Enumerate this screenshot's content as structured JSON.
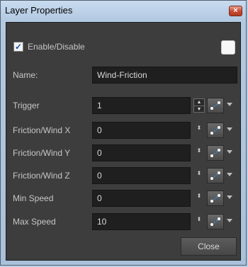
{
  "window": {
    "title": "Layer Properties",
    "close_glyph": "×"
  },
  "enable": {
    "label": "Enable/Disable",
    "checked": true,
    "check_glyph": "✓"
  },
  "color_swatch": {
    "color": "#f7f7f7"
  },
  "name_field": {
    "label": "Name:",
    "value": "Wind-Friction"
  },
  "params": [
    {
      "label": "Trigger",
      "value": "1"
    },
    {
      "label": "Friction/Wind X",
      "value": "0"
    },
    {
      "label": "Friction/Wind Y",
      "value": "0"
    },
    {
      "label": "Friction/Wind Z",
      "value": "0"
    },
    {
      "label": "Min Speed",
      "value": "0"
    },
    {
      "label": "Max Speed",
      "value": "10"
    }
  ],
  "spin_glyphs": {
    "up": "▲",
    "down": "▼",
    "small": "⬍"
  },
  "function_icon": "function-curve-icon",
  "buttons": {
    "close_label": "Close"
  },
  "colors": {
    "panel_bg": "#3d3d3d",
    "field_bg": "#1f1f1f",
    "curve_accent": "#2e8fe0"
  }
}
